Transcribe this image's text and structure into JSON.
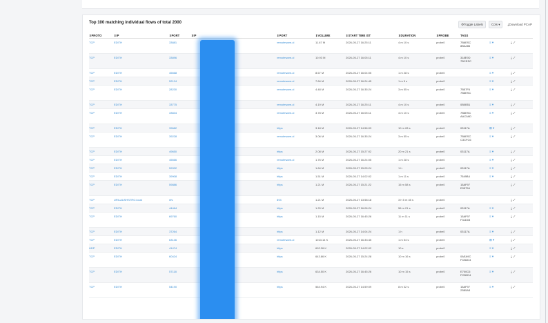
{
  "title": "Top 100 matching individual flows of total 2000",
  "actions": {
    "toggle_labels": "Toggle Labels",
    "cols": "Cols",
    "download_pcap": "Download PCAP"
  },
  "columns": [
    "PROTO",
    "IP",
    "PORT",
    "IP",
    "PORT",
    "VOLUME",
    "START TIME IST",
    "DURATION",
    "PROBE",
    "TAGS"
  ],
  "rows": [
    {
      "proto": "TCP",
      "ip": "EDITH",
      "port": "33881",
      "port2": "remoteware-cl",
      "volume": "11.67 M",
      "start": "2026-05-27 16:25:11",
      "duration": "4 m 10 s",
      "probe": "probe0",
      "tags": [
        "7B6ESC",
        "8BA286"
      ],
      "tall": true,
      "act": "≡ ▾"
    },
    {
      "proto": "TCP",
      "ip": "EDITH",
      "port": "33896",
      "port2": "remoteware-cl",
      "volume": "10.93 M",
      "start": "2026-05-27 16:05:11",
      "duration": "4 m 10 s",
      "probe": "probe0",
      "tags": [
        "318E9D",
        "7BCESC"
      ],
      "tall": true,
      "act": "≡ ▾"
    },
    {
      "proto": "TCP",
      "ip": "EDITH",
      "port": "45668",
      "port2": "remoteware-cl",
      "volume": "8.67 M",
      "start": "2026-05-27 16:04:05",
      "duration": "1 m 28 s",
      "probe": "probe0",
      "tags": [],
      "tall": false,
      "act": "≡ ▾"
    },
    {
      "proto": "TCP",
      "ip": "EDITH",
      "port": "52124",
      "port2": "remoteware-cl",
      "volume": "7.84 M",
      "start": "2026-05-27 16:24:45",
      "duration": "1 m 5 s",
      "probe": "probe0",
      "tags": [],
      "tall": false,
      "act": "≡ ▾"
    },
    {
      "proto": "TCP",
      "ip": "EDITH",
      "port": "28230",
      "port2": "remoteware-cl",
      "volume": "4.48 M",
      "start": "2026-05-27 16:35:24",
      "duration": "3 m 55 s",
      "probe": "probe0",
      "tags": [
        "7B57F6",
        "7B6ESC"
      ],
      "tall": true,
      "act": "≡ ▾"
    },
    {
      "proto": "TCP",
      "ip": "EDITH",
      "port": "33775",
      "port2": "remoteware-cl",
      "volume": "4.19 M",
      "start": "2026-05-27 16:25:11",
      "duration": "4 m 10 s",
      "probe": "probe0",
      "tags": [
        "0B0B51"
      ],
      "tall": false,
      "act": "≡ ▾"
    },
    {
      "proto": "TCP",
      "ip": "EDITH",
      "port": "33834",
      "port2": "remoteware-cl",
      "volume": "3.78 M",
      "start": "2026-05-27 16:05:11",
      "duration": "4 m 10 s",
      "probe": "probe0",
      "tags": [
        "7B6ESC",
        "AAC0AD"
      ],
      "tall": true,
      "act": "≡ ▾"
    },
    {
      "proto": "TCP",
      "ip": "EDITH",
      "port": "39682",
      "port2": "https",
      "volume": "3.18 M",
      "start": "2026-05-27 14:56:03",
      "duration": "10 m 28 s",
      "probe": "probe0",
      "tags": [
        "03117A"
      ],
      "tall": false,
      "act": "⊞ ▾"
    },
    {
      "proto": "TCP",
      "ip": "EDITH",
      "port": "39228",
      "port2": "remoteware-cl",
      "volume": "3.06 M",
      "start": "2026-05-27 16:35:24",
      "duration": "3 m 55 s",
      "probe": "probe0",
      "tags": [
        "7B6ESC",
        "C3CFC6"
      ],
      "tall": true,
      "act": "≡ ▾"
    },
    {
      "proto": "TCP",
      "ip": "EDITH",
      "port": "49650",
      "port2": "https",
      "volume": "2.08 M",
      "start": "2026-05-27 15:27:02",
      "duration": "20 m 21 s",
      "probe": "probe0",
      "tags": [
        "03117A"
      ],
      "tall": false,
      "act": "≡ ▾"
    },
    {
      "proto": "TCP",
      "ip": "EDITH",
      "port": "45666",
      "port2": "remoteware-cl",
      "volume": "1.76 M",
      "start": "2026-05-27 16:24:05",
      "duration": "1 m 28 s",
      "probe": "probe0",
      "tags": [],
      "tall": false,
      "act": "≡ ▾"
    },
    {
      "proto": "TCP",
      "ip": "EDITH",
      "port": "59332",
      "port2": "https",
      "volume": "1.64 M",
      "start": "2026-05-27 15:05:24",
      "duration": "1 h",
      "probe": "probe0",
      "tags": [
        "03117A"
      ],
      "tall": false,
      "act": "≡ ▾"
    },
    {
      "proto": "TCP",
      "ip": "EDITH",
      "port": "39908",
      "port2": "https",
      "volume": "1.51 M",
      "start": "2026-05-27 14:02:02",
      "duration": "1 m 11 s",
      "probe": "probe0",
      "tags": [
        "7549B4"
      ],
      "tall": false,
      "act": "≡ ▾"
    },
    {
      "proto": "TCP",
      "ip": "EDITH",
      "port": "59886",
      "port2": "https",
      "volume": "1.21 M",
      "start": "2026-05-27 15:21:22",
      "duration": "15 m 58 s",
      "probe": "probe0",
      "tags": [
        "15AF97",
        "E95754"
      ],
      "tall": true,
      "act": ""
    },
    {
      "proto": "TCP",
      "ip": "URILAUSHSTRO.local",
      "port": "nfs",
      "port2": "894",
      "volume": "1.21 M",
      "start": "2026-05-27 13:58:18",
      "duration": "3 h 5 m 45 s",
      "probe": "probe0",
      "tags": [],
      "tall": false,
      "act": ""
    },
    {
      "proto": "TCP",
      "ip": "EDITH",
      "port": "44464",
      "port2": "https",
      "volume": "1.20 M",
      "start": "2026-05-27 16:06:24",
      "duration": "56 m 21 s",
      "probe": "probe0",
      "tags": [
        "03117A"
      ],
      "tall": false,
      "act": "≡ ▾"
    },
    {
      "proto": "TCP",
      "ip": "EDITH",
      "port": "69760",
      "port2": "https",
      "volume": "1.15 M",
      "start": "2026-05-27 16:45:26",
      "duration": "11 m 11 s",
      "probe": "probe0",
      "tags": [
        "15AF97",
        "F31D03"
      ],
      "tall": true,
      "act": "≡ ▾"
    },
    {
      "proto": "TCP",
      "ip": "EDITH",
      "port": "37264",
      "port2": "https",
      "volume": "1.12 M",
      "start": "2026-05-27 14:04:24",
      "duration": "1 h",
      "probe": "probe0",
      "tags": [
        "03117A"
      ],
      "tall": false,
      "act": "≡ ▾"
    },
    {
      "proto": "TCP",
      "ip": "EDITH",
      "port": "63136",
      "port2": "remoteware-cl",
      "volume": "1013.14 K",
      "start": "2026-05-27 16:33:45",
      "duration": "1 m 54 s",
      "probe": "probe0",
      "tags": [],
      "tall": false,
      "act": "⊞ ▾"
    },
    {
      "proto": "UDP",
      "ip": "EDITH",
      "port": "41474",
      "port2": "https",
      "volume": "692.26 K",
      "start": "2026-05-27 14:02:02",
      "duration": "10 s",
      "probe": "probe0",
      "tags": [],
      "tall": false,
      "act": "≡ ▾"
    },
    {
      "proto": "TCP",
      "ip": "EDITH",
      "port": "60424",
      "port2": "https",
      "volume": "643.86 K",
      "start": "2026-05-27 15:24:28",
      "duration": "10 m 16 s",
      "probe": "probe0",
      "tags": [
        "0AEA9C",
        "FCB2D4"
      ],
      "tall": true,
      "act": "≡ ▾"
    },
    {
      "proto": "TCP",
      "ip": "EDITH",
      "port": "57118",
      "port2": "https",
      "volume": "634.50 K",
      "start": "2026-05-27 16:45:26",
      "duration": "10 m 15 s",
      "probe": "probe0",
      "tags": [
        "E700C6",
        "FCB2D4"
      ],
      "tall": true,
      "act": "≡ ▾"
    },
    {
      "proto": "TCP",
      "ip": "EDITH",
      "port": "54190",
      "port2": "https",
      "volume": "564.94 K",
      "start": "2026-05-27 14:59:09",
      "duration": "8 m 32 s",
      "probe": "probe0",
      "tags": [
        "15AF97",
        "23B5A3"
      ],
      "tall": true,
      "act": "≡ ▾"
    }
  ]
}
